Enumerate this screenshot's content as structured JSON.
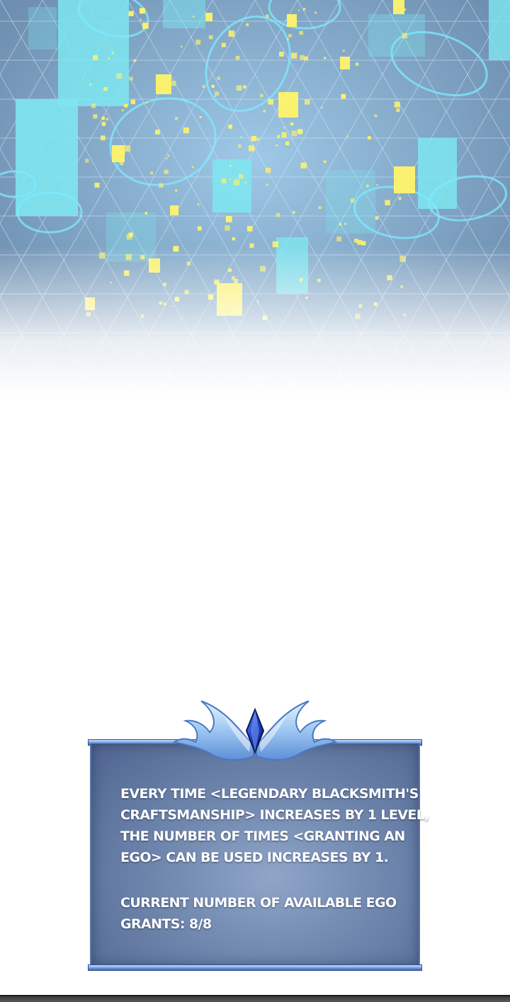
{
  "status_window": {
    "paragraph_1": [
      "EVERY TIME <LEGENDARY BLACKSMITH'S",
      "CRAFTSMANSHIP> INCREASES BY 1 LEVEL,",
      "THE NUMBER OF TIMES <GRANTING AN",
      "EGO> CAN BE USED INCREASES BY 1."
    ],
    "paragraph_2": [
      "CURRENT NUMBER OF AVAILABLE EGO",
      "GRANTS: 8/8"
    ],
    "ego_grants": {
      "current": 8,
      "max": 8
    }
  },
  "artwork": {
    "description_icon": "gem-crest-icon",
    "colors": {
      "grid": "#cfe6ff",
      "background": "#6f8fb0",
      "blocks": "#7ee6f0",
      "sparks": "#fff36a",
      "window_top": "#4f6590",
      "rail": "#6f9be0"
    }
  }
}
